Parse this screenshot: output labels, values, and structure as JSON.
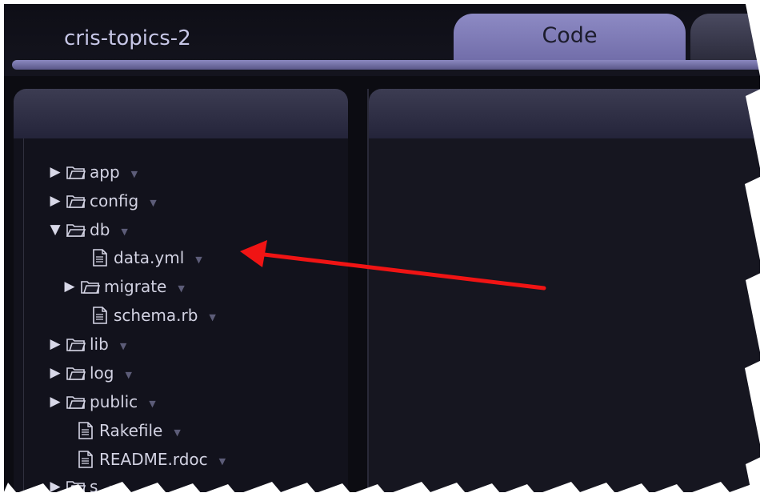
{
  "project": {
    "title": "cris-topics-2"
  },
  "tabs": {
    "active_label": "Code"
  },
  "colors": {
    "background": "#0c0c12",
    "tab_active": "#8a86c2",
    "tab_strip": "#7470aa",
    "annotation_arrow": "#f01414"
  },
  "file_tree": {
    "items": [
      {
        "label": "app",
        "type": "folder",
        "expanded": false,
        "icon": "folder-icon"
      },
      {
        "label": "config",
        "type": "folder",
        "expanded": false,
        "icon": "folder-icon"
      },
      {
        "label": "db",
        "type": "folder",
        "expanded": true,
        "icon": "folder-open-icon"
      },
      {
        "label": "data.yml",
        "type": "file",
        "icon": "file-icon"
      },
      {
        "label": "migrate",
        "type": "folder",
        "expanded": false,
        "icon": "folder-icon"
      },
      {
        "label": "schema.rb",
        "type": "file",
        "icon": "file-icon"
      },
      {
        "label": "lib",
        "type": "folder",
        "expanded": false,
        "icon": "folder-icon"
      },
      {
        "label": "log",
        "type": "folder",
        "expanded": false,
        "icon": "folder-icon"
      },
      {
        "label": "public",
        "type": "folder",
        "expanded": false,
        "icon": "folder-icon"
      },
      {
        "label": "Rakefile",
        "type": "file",
        "icon": "file-icon"
      },
      {
        "label": "README.rdoc",
        "type": "file",
        "icon": "file-icon"
      },
      {
        "label": "s",
        "type": "folder",
        "expanded": false,
        "icon": "folder-icon"
      }
    ]
  },
  "annotation": {
    "type": "arrow",
    "points_to": "data.yml"
  }
}
